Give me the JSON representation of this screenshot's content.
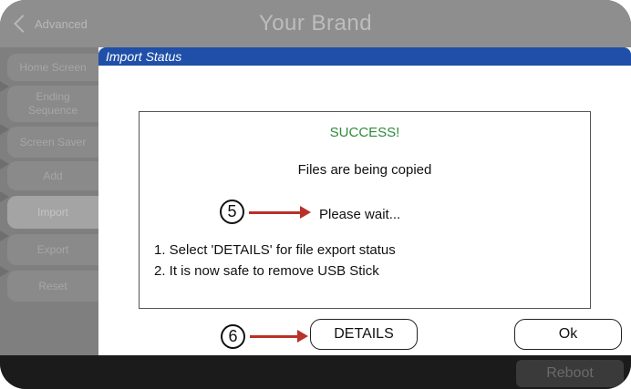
{
  "topbar": {
    "back_label": "Advanced",
    "brand": "Your Brand"
  },
  "sidebar": {
    "items": [
      {
        "label": "Home Screen"
      },
      {
        "label": "Ending Sequence"
      },
      {
        "label": "Screen Saver"
      },
      {
        "label": "Add"
      },
      {
        "label": "Import"
      },
      {
        "label": "Export"
      },
      {
        "label": "Reset"
      }
    ]
  },
  "dialog": {
    "title": "Import Status",
    "success": "SUCCESS!",
    "copying": "Files are being copied",
    "wait": "Please wait...",
    "steps": [
      "1. Select 'DETAILS' for file export status",
      "2. It is now safe to remove USB Stick"
    ],
    "details_label": "DETAILS",
    "ok_label": "Ok"
  },
  "callouts": {
    "wait": "5",
    "details": "6"
  },
  "bottombar": {
    "reboot_label": "Reboot"
  },
  "colors": {
    "title_bar": "#1f4fa8",
    "success": "#2e8b3c",
    "arrow": "#b8312a"
  }
}
